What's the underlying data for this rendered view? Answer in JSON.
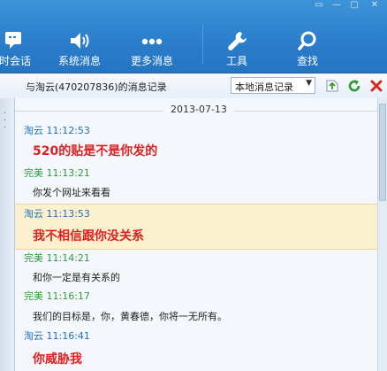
{
  "toolbar": {
    "items": [
      {
        "label": "时会话",
        "icon": "chat-icon"
      },
      {
        "label": "系统消息",
        "icon": "speaker-icon"
      },
      {
        "label": "更多消息",
        "icon": "more-dots-icon"
      },
      {
        "label": "工具",
        "icon": "wrench-icon"
      },
      {
        "label": "查找",
        "icon": "search-icon"
      }
    ]
  },
  "header": {
    "subtitle": "与淘云(470207836)的消息记录",
    "dropdown_value": "本地消息记录"
  },
  "date": "2013-07-13",
  "messages": [
    {
      "sender": "淘云",
      "time": "11:12:53",
      "text": "520的贴是不是你发的",
      "style": "big-red",
      "sender_color": "blue"
    },
    {
      "sender": "完美",
      "time": "11:13:21",
      "text": "你发个网址来看看",
      "style": "normal",
      "sender_color": "green"
    },
    {
      "sender": "淘云",
      "time": "11:13:53",
      "text": "我不相信跟你没关系",
      "style": "big-red",
      "sender_color": "blue",
      "highlighted": true
    },
    {
      "sender": "完美",
      "time": "11:14:21",
      "text": "和你一定是有关系的",
      "style": "normal",
      "sender_color": "green"
    },
    {
      "sender": "完美",
      "time": "11:16:17",
      "text": "我们的目标是，你，黄春德，你将一无所有。",
      "style": "normal",
      "sender_color": "green"
    },
    {
      "sender": "淘云",
      "time": "11:16:41",
      "text": "你威胁我",
      "style": "big-red",
      "sender_color": "blue"
    }
  ],
  "colors": {
    "toolbar_bg": "#2c7fcc",
    "sender_blue": "#1f6fc0",
    "sender_green": "#2d9a3d",
    "emphasis_red": "#e02020",
    "highlight_bg": "#fcf1cf"
  }
}
